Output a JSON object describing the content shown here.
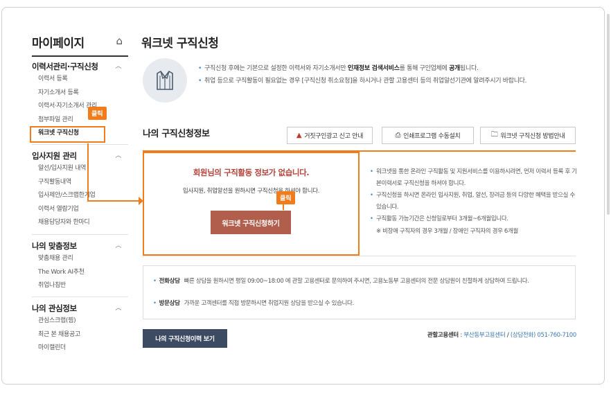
{
  "sidebar": {
    "title": "마이페이지",
    "home_icon": "home-icon",
    "groups": [
      {
        "head": "이력서관리·구직신청",
        "items": [
          "이력서 등록",
          "자기소개서 등록",
          "이력서·자기소개서 관리",
          "첨부파일 관리",
          "워크넷 구직신청"
        ]
      },
      {
        "head": "입사지원 관리",
        "items": [
          "알선/입사지원 내역",
          "구직활동내역",
          "입사제안/스크랩한기업",
          "이력서 열람기업",
          "채용담당자와 한마디"
        ]
      },
      {
        "head": "나의 맞춤정보",
        "items": [
          "맞춤채용 관리",
          "The Work AI추천",
          "취업나침반"
        ]
      },
      {
        "head": "나의 관심정보",
        "items": [
          "관심스크랩(찜)",
          "최근 본 채용공고",
          "마이캘린더"
        ]
      }
    ]
  },
  "badges": {
    "click1": "클릭",
    "click2": "클릭"
  },
  "page": {
    "title": "워크넷 구직신청"
  },
  "info": {
    "line1_a": "구직신청 후에는 기본으로 설정한 이력서와 자기소개서만 ",
    "line1_b": "인재정보 검색서비스",
    "line1_c": "를 통해 구인업체에 ",
    "line1_d": "공개",
    "line1_e": "됩니다.",
    "line2": "취업 등으로 구직활동이 필요없는 경우 [구직신청 취소요청]을 하시거나 관할 고용센터 등의 취업알선기관에 알려주시기 바랍니다."
  },
  "section": {
    "title": "나의 구직신청정보",
    "buttons": [
      "거짓구인광고 신고 안내",
      "인쇄프로그램 수동설치",
      "워크넷 구직신청 방법안내"
    ]
  },
  "status": {
    "message": "회원님의 구직활동 정보가 없습니다.",
    "sub": "입사지원, 취업알선을 원하시면 구직신청을 하셔야 합니다.",
    "apply_button": "워크넷 구직신청하기",
    "notes": [
      "워크넷을 통한 온라인 구직활동 및 지원서비스를 이용하시려면, 먼저 이력서 등록 후 기본이력서로 구직신청을 하셔야 합니다.",
      "구직신청을 하시면 온라인 입사지원, 취업, 알선, 장려금 등의 다양한 혜택을 받으실 수 있습니다.",
      "구직활동 가능기간은 신청일로부터 3개월~6개월입니다."
    ],
    "note_sub": "※ 비장애 구직자의 경우 3개월 / 장애인 구직자의 경우 6개월"
  },
  "consult": {
    "phone_label": "전화상담",
    "phone_text": "빠른 상담을 원하시면 평일 09:00~18:00 에 관할 고용센터로 문의하여 주시면, 고용노동부 고용센터의 전문 상담원이 친절하게 상담하여 드립니다.",
    "visit_label": "방문상담",
    "visit_text": "가까운 고객센터를 직접 방문하시면 취업지원 상담을 받으실 수 있습니다."
  },
  "footer": {
    "history_button": "나의 구직신청이력 보기",
    "center_label": "관할고용센터",
    "center_name": "부산동부고용센터",
    "center_phone": "(상담전화) 051-760-7100"
  },
  "colors": {
    "accent": "#f07c1c",
    "apply": "#b25e4d",
    "history": "#3c4a62",
    "link": "#3a78b5"
  }
}
